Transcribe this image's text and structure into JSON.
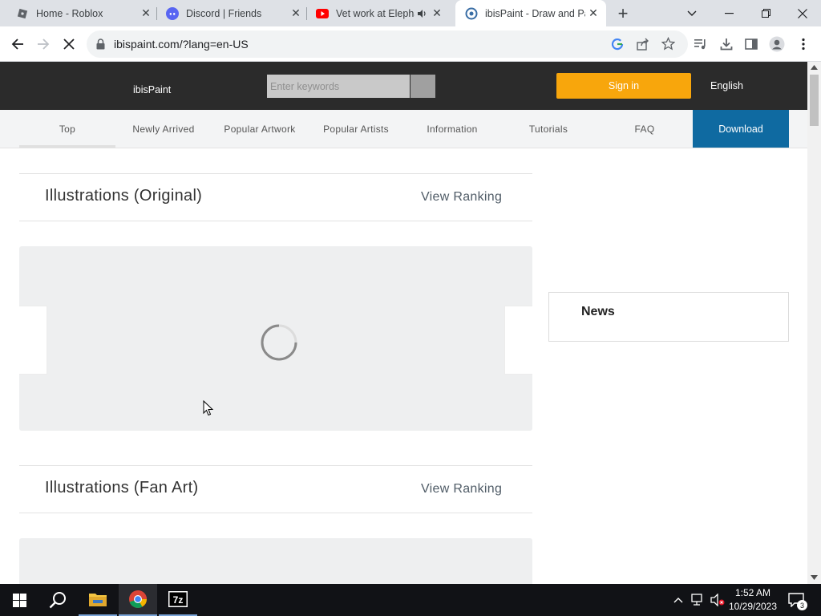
{
  "browser": {
    "tabs": [
      {
        "title": "Home - Roblox",
        "icon": "roblox-icon"
      },
      {
        "title": "Discord | Friends",
        "icon": "discord-icon"
      },
      {
        "title": "Vet work at Elephant",
        "icon": "youtube-icon",
        "audio": true
      },
      {
        "title": "ibisPaint - Draw and Paint",
        "icon": "ibispaint-icon",
        "active": true
      }
    ],
    "new_tab_label": "+",
    "url": "ibispaint.com/?lang=en-US"
  },
  "site": {
    "logo": "ibisPaint",
    "search_placeholder": "Enter keywords",
    "signin_label": "Sign in",
    "language_label": "English",
    "nav": [
      "Top",
      "Newly Arrived",
      "Popular Artwork",
      "Popular Artists",
      "Information",
      "Tutorials",
      "FAQ"
    ],
    "download_label": "Download",
    "sections": [
      {
        "title": "Illustrations (Original)",
        "link": "View Ranking"
      },
      {
        "title": "Illustrations (Fan Art)",
        "link": "View Ranking"
      }
    ],
    "news_title": "News"
  },
  "taskbar": {
    "time": "1:52 AM",
    "date": "10/29/2023",
    "notification_count": "3",
    "apps": [
      "start-icon",
      "search-icon",
      "file-explorer-icon",
      "chrome-icon",
      "7zip-icon"
    ]
  },
  "colors": {
    "header_bg": "#2b2b2b",
    "signin_orange": "#f8a60c",
    "download_blue": "#0f6aa1"
  }
}
